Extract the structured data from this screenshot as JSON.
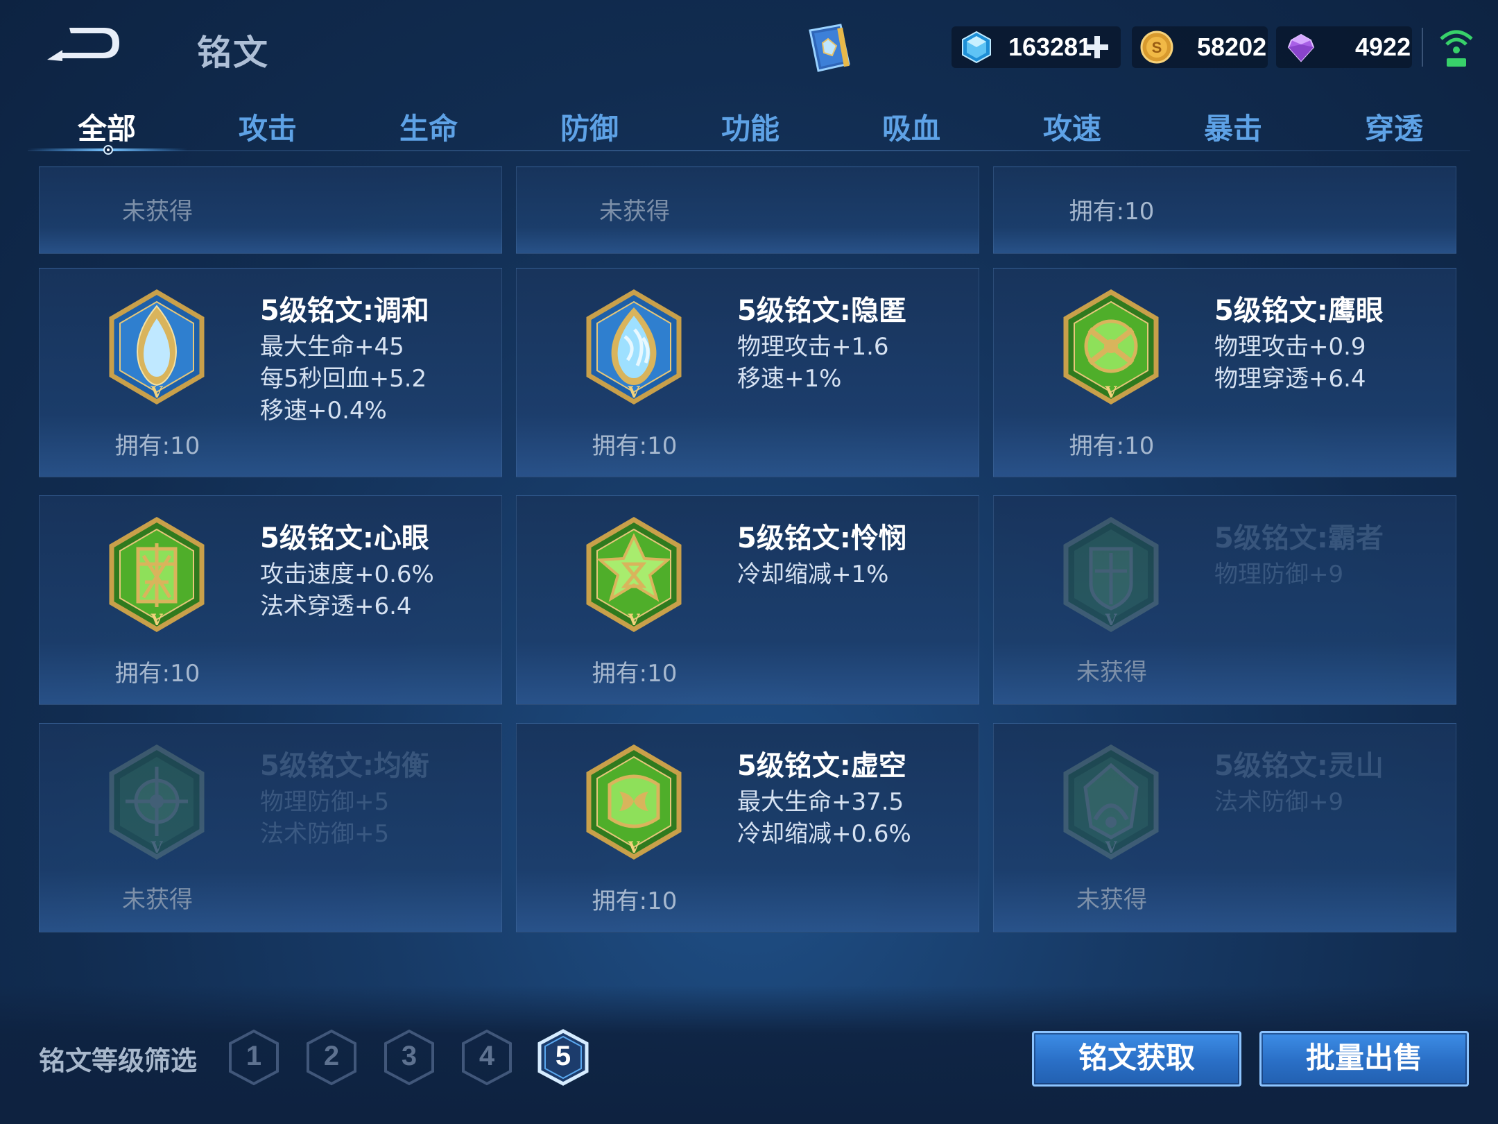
{
  "header": {
    "title": "铭文",
    "currencies": {
      "diamond": "163281",
      "coin": "58202",
      "gem": "4922"
    }
  },
  "tabs": [
    {
      "label": "全部",
      "active": true
    },
    {
      "label": "攻击"
    },
    {
      "label": "生命"
    },
    {
      "label": "防御"
    },
    {
      "label": "功能"
    },
    {
      "label": "吸血"
    },
    {
      "label": "攻速"
    },
    {
      "label": "暴击"
    },
    {
      "label": "穿透"
    }
  ],
  "partial_row": [
    {
      "owned": "未获得"
    },
    {
      "owned": "未获得"
    },
    {
      "owned": "拥有:10"
    }
  ],
  "runes": [
    {
      "name": "5级铭文:调和",
      "stats": [
        "最大生命+45",
        "每5秒回血+5.2",
        "移速+0.4%"
      ],
      "owned": "拥有:10",
      "icon": "harmony-emblem-icon"
    },
    {
      "name": "5级铭文:隐匿",
      "stats": [
        "物理攻击+1.6",
        "移速+1%"
      ],
      "owned": "拥有:10",
      "icon": "stealth-emblem-icon"
    },
    {
      "name": "5级铭文:鹰眼",
      "stats": [
        "物理攻击+0.9",
        "物理穿透+6.4"
      ],
      "owned": "拥有:10",
      "icon": "hawkeye-emblem-icon"
    },
    {
      "name": "5级铭文:心眼",
      "stats": [
        "攻击速度+0.6%",
        "法术穿透+6.4"
      ],
      "owned": "拥有:10",
      "icon": "mind-eye-emblem-icon"
    },
    {
      "name": "5级铭文:怜悯",
      "stats": [
        "冷却缩减+1%"
      ],
      "owned": "拥有:10",
      "icon": "compassion-emblem-icon"
    },
    {
      "name": "5级铭文:霸者",
      "stats": [
        "物理防御+9"
      ],
      "owned": "未获得",
      "icon": "overlord-emblem-icon"
    },
    {
      "name": "5级铭文:均衡",
      "stats": [
        "物理防御+5",
        "法术防御+5"
      ],
      "owned": "未获得",
      "icon": "balance-emblem-icon"
    },
    {
      "name": "5级铭文:虚空",
      "stats": [
        "最大生命+37.5",
        "冷却缩减+0.6%"
      ],
      "owned": "拥有:10",
      "icon": "void-emblem-icon"
    },
    {
      "name": "5级铭文:灵山",
      "stats": [
        "法术防御+9"
      ],
      "owned": "未获得",
      "icon": "spirit-mountain-emblem-icon"
    }
  ],
  "footer": {
    "filter_label": "铭文等级筛选",
    "levels": [
      "1",
      "2",
      "3",
      "4",
      "5"
    ],
    "active_level": "5",
    "obtain_button": "铭文获取",
    "sell_button": "批量出售"
  },
  "colors": {
    "background": "#173a66",
    "tab_inactive": "#5ea2e6",
    "tab_active": "#ffffff",
    "button": "#2a6fc6",
    "emblem_gold": "#c9a04a",
    "emblem_blue": "#1d5fa8",
    "emblem_green": "#3f9a2a"
  }
}
